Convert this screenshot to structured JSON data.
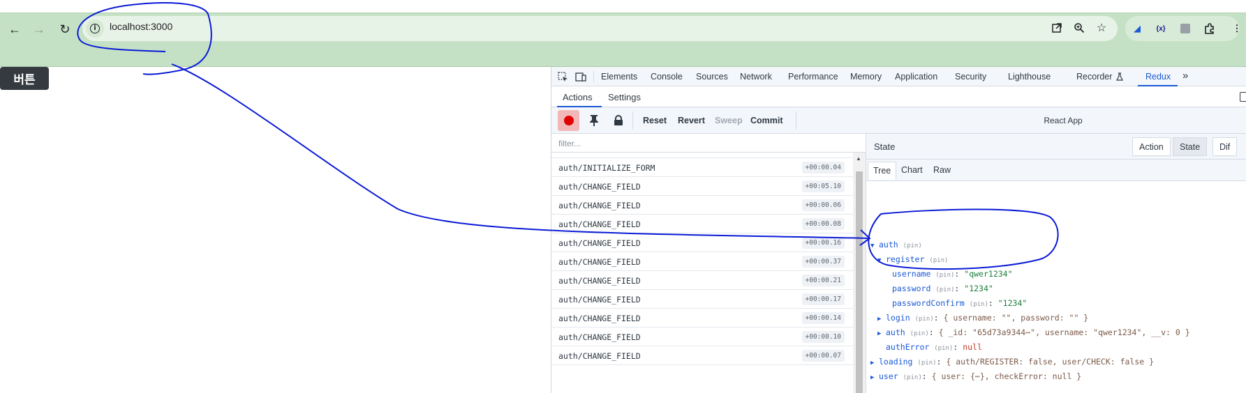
{
  "browser": {
    "url": "localhost:3000",
    "back_icon": "arrow-left",
    "forward_icon": "arrow-right",
    "reload_icon": "reload",
    "site_info_icon": "info",
    "open_in_icon": "external-link",
    "zoom_icon": "magnifier",
    "bookmark_icon": "star",
    "extensions_icon": "puzzle"
  },
  "page": {
    "button_label": "버튼"
  },
  "devtools": {
    "tabs": [
      "Elements",
      "Console",
      "Sources",
      "Network",
      "Performance",
      "Memory",
      "Application",
      "Security",
      "Lighthouse",
      "Recorder",
      "Redux"
    ],
    "active_tab": "Redux",
    "more_tabs": "»",
    "redux": {
      "sub_tabs": [
        "Actions",
        "Settings"
      ],
      "active_sub_tab": "Actions",
      "controls": {
        "reset": "Reset",
        "revert": "Revert",
        "sweep": "Sweep",
        "commit": "Commit",
        "instance": "React App"
      },
      "filter_placeholder": "filter...",
      "actions": [
        {
          "name": "auth/INITIALIZE_FORM",
          "time": "+00:00.04"
        },
        {
          "name": "auth/CHANGE_FIELD",
          "time": "+00:05.10"
        },
        {
          "name": "auth/CHANGE_FIELD",
          "time": "+00:00.06"
        },
        {
          "name": "auth/CHANGE_FIELD",
          "time": "+00:00.08"
        },
        {
          "name": "auth/CHANGE_FIELD",
          "time": "+00:00.16"
        },
        {
          "name": "auth/CHANGE_FIELD",
          "time": "+00:00.37"
        },
        {
          "name": "auth/CHANGE_FIELD",
          "time": "+00:00.21"
        },
        {
          "name": "auth/CHANGE_FIELD",
          "time": "+00:00.17"
        },
        {
          "name": "auth/CHANGE_FIELD",
          "time": "+00:00.14"
        },
        {
          "name": "auth/CHANGE_FIELD",
          "time": "+00:00.10"
        },
        {
          "name": "auth/CHANGE_FIELD",
          "time": "+00:00.07"
        }
      ],
      "state_header": "State",
      "mode_buttons": [
        "Action",
        "State",
        "Dif"
      ],
      "active_mode": "State",
      "view_tabs": [
        "Tree",
        "Chart",
        "Raw"
      ],
      "active_view": "Tree",
      "tree": {
        "pin": "(pin)",
        "auth_key": "auth",
        "register_key": "register",
        "username_key": "username",
        "username_val": "\"qwer1234\"",
        "password_key": "password",
        "password_val": "\"1234\"",
        "passwordConfirm_key": "passwordConfirm",
        "passwordConfirm_val": "\"1234\"",
        "login_key": "login",
        "login_summary": "{ username: \"\", password: \"\" }",
        "auth_inner_key": "auth",
        "auth_inner_summary": "{ _id: \"65d73a9344⋯\", username: \"qwer1234\", __v: 0 }",
        "authError_key": "authError",
        "authError_val": "null",
        "loading_key": "loading",
        "loading_summary": "{ auth/REGISTER: false, user/CHECK: false }",
        "user_key": "user",
        "user_summary": "{ user: {⋯}, checkError: null }"
      }
    }
  },
  "colors": {
    "toolbar": "#c5e1c5",
    "accent": "#1a58d6",
    "annotation_stroke": "#0a1ad6",
    "page_button": "#343a40"
  }
}
